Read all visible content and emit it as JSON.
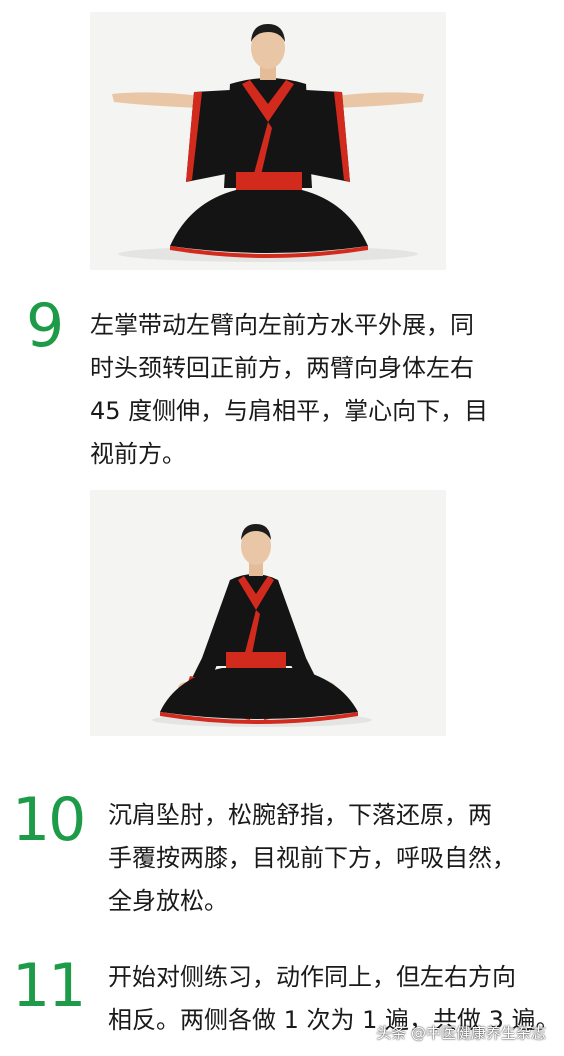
{
  "steps": [
    {
      "number": "9",
      "lines": [
        "左掌带动左臂向左前方水平外展，同",
        "时头颈转回正前方，两臂向身体左右",
        "45 度侧伸，与肩相平，掌心向下，目",
        "视前方。"
      ]
    },
    {
      "number": "10",
      "lines": [
        "沉肩坠肘，松腕舒指，下落还原，两",
        "手覆按两膝，目视前下方，呼吸自然，",
        "全身放松。"
      ]
    },
    {
      "number": "11",
      "lines": [
        "开始对侧练习，动作同上，但左右方向",
        "相反。两侧各做 1 次为 1 遍，共做 3 遍。"
      ]
    }
  ],
  "watermark": "头条 @中医健康养生杂志",
  "colors": {
    "step_number": "#1e9b48",
    "robe_black": "#141414",
    "robe_red": "#d32a1e",
    "background": "#ffffff"
  }
}
